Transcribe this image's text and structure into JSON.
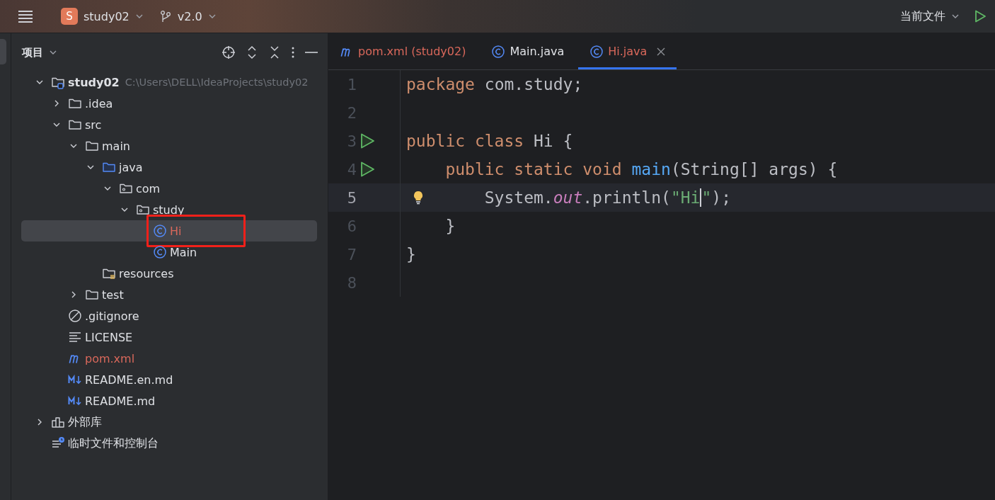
{
  "title_bar": {
    "project": {
      "badge": "S",
      "name": "study02"
    },
    "branch": "v2.0",
    "run_config": "当前文件"
  },
  "project_panel": {
    "title": "项目",
    "tree": [
      {
        "label": "study02",
        "hint": "C:\\Users\\DELL\\IdeaProjects\\study02",
        "kind": "module",
        "expanded": true,
        "selected": false,
        "modified": false,
        "children": [
          {
            "label": ".idea",
            "kind": "folder",
            "expanded": false,
            "selected": false,
            "modified": false
          },
          {
            "label": "src",
            "kind": "folder",
            "expanded": true,
            "selected": false,
            "modified": false,
            "children": [
              {
                "label": "main",
                "kind": "folder",
                "expanded": true,
                "selected": false,
                "modified": false,
                "children": [
                  {
                    "label": "java",
                    "kind": "source",
                    "expanded": true,
                    "selected": false,
                    "modified": false,
                    "children": [
                      {
                        "label": "com",
                        "kind": "package",
                        "expanded": true,
                        "selected": false,
                        "modified": false,
                        "children": [
                          {
                            "label": "study",
                            "kind": "package",
                            "expanded": true,
                            "selected": false,
                            "modified": false,
                            "children": [
                              {
                                "label": "Hi",
                                "kind": "class",
                                "selected": true,
                                "modified": true,
                                "outlined": true
                              },
                              {
                                "label": "Main",
                                "kind": "class",
                                "selected": false,
                                "modified": false
                              }
                            ]
                          }
                        ]
                      }
                    ]
                  },
                  {
                    "label": "resources",
                    "kind": "resources",
                    "selected": false,
                    "modified": false
                  }
                ]
              },
              {
                "label": "test",
                "kind": "folder",
                "expanded": false,
                "selected": false,
                "modified": false
              }
            ]
          },
          {
            "label": ".gitignore",
            "kind": "ignore",
            "selected": false,
            "modified": false
          },
          {
            "label": "LICENSE",
            "kind": "text",
            "selected": false,
            "modified": false
          },
          {
            "label": "pom.xml",
            "kind": "maven",
            "selected": false,
            "modified": true
          },
          {
            "label": "README.en.md",
            "kind": "markdown",
            "selected": false,
            "modified": false
          },
          {
            "label": "README.md",
            "kind": "markdown",
            "selected": false,
            "modified": false
          }
        ]
      },
      {
        "label": "外部库",
        "kind": "library",
        "expanded": false,
        "selected": false,
        "modified": false
      },
      {
        "label": "临时文件和控制台",
        "kind": "scratch",
        "selected": false,
        "modified": false
      }
    ]
  },
  "editor": {
    "tabs": [
      {
        "label": "pom.xml (study02)",
        "kind": "maven",
        "selected": false,
        "modified": true
      },
      {
        "label": "Main.java",
        "kind": "class",
        "selected": false,
        "modified": false
      },
      {
        "label": "Hi.java",
        "kind": "class",
        "selected": true,
        "modified": true
      }
    ],
    "lines": [
      {
        "number": "1",
        "run": false,
        "current": false,
        "bulb": false,
        "tokens": [
          {
            "kind": "keyword",
            "text": "package"
          },
          {
            "kind": "plain",
            "text": " com.study;"
          }
        ]
      },
      {
        "number": "2",
        "run": false,
        "current": false,
        "bulb": false
      },
      {
        "number": "3",
        "run": true,
        "current": false,
        "bulb": false,
        "tokens": [
          {
            "kind": "keyword",
            "text": "public class"
          },
          {
            "kind": "plain",
            "text": " Hi {"
          }
        ]
      },
      {
        "number": "4",
        "run": true,
        "current": false,
        "bulb": false,
        "tokens": [
          {
            "kind": "keyword",
            "text": "    public static void "
          },
          {
            "kind": "method",
            "text": "main"
          },
          {
            "kind": "plain",
            "text": "(String[] args) {"
          }
        ]
      },
      {
        "number": "5",
        "run": false,
        "current": true,
        "bulb": true,
        "tokens": [
          {
            "kind": "plain",
            "text": "        System."
          },
          {
            "kind": "static",
            "text": "out"
          },
          {
            "kind": "plain",
            "text": ".println("
          },
          {
            "kind": "string",
            "text": "\"Hi"
          },
          {
            "kind": "caret"
          },
          {
            "kind": "string",
            "text": "\""
          },
          {
            "kind": "plain",
            "text": ");"
          }
        ]
      },
      {
        "number": "6",
        "run": false,
        "current": false,
        "bulb": false,
        "tokens": [
          {
            "kind": "plain",
            "text": "    }"
          }
        ]
      },
      {
        "number": "7",
        "run": false,
        "current": false,
        "bulb": false,
        "tokens": [
          {
            "kind": "plain",
            "text": "}"
          }
        ]
      },
      {
        "number": "8",
        "run": false,
        "current": false,
        "bulb": false
      }
    ]
  }
}
